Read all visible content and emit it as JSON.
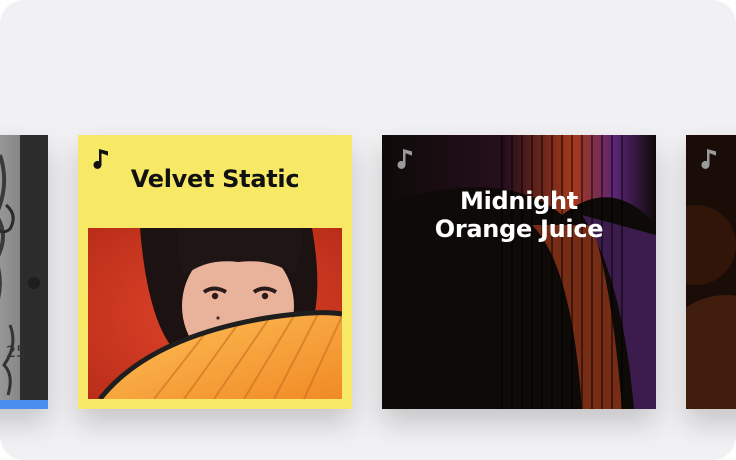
{
  "cards": [
    {
      "id": "partial-left",
      "title": "",
      "icon": "music-note-icon"
    },
    {
      "id": "velvet-static",
      "title": "Velvet Static",
      "icon": "music-note-icon",
      "accent": "#f7e865"
    },
    {
      "id": "midnight-orange-juice",
      "title_line1": "Midnight",
      "title_line2": "Orange Juice",
      "icon": "music-note-icon",
      "accent": "#0e0a08"
    },
    {
      "id": "partial-right",
      "title": "",
      "icon": "music-note-icon"
    }
  ],
  "colors": {
    "panel_bg": "#f1f1f4",
    "progress_accent": "#4a8ff0"
  }
}
